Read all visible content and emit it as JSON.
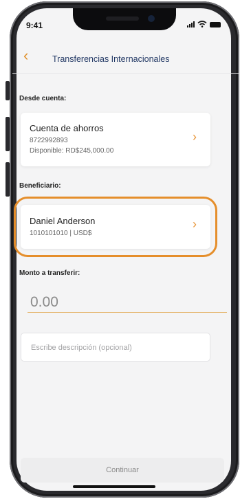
{
  "status": {
    "time": "9:41"
  },
  "nav": {
    "back_icon": "chevron-left-icon",
    "title": "Transferencias Internacionales"
  },
  "from": {
    "label": "Desde cuenta:",
    "account_name": "Cuenta de ahorros",
    "account_number": "8722992893",
    "available": "Disponible: RD$245,000.00"
  },
  "beneficiary": {
    "label": "Beneficiario:",
    "name": "Daniel Anderson",
    "details": "1010101010 | USD$"
  },
  "amount": {
    "label": "Monto a transferir:",
    "value": "0.00"
  },
  "description": {
    "placeholder": "Escribe descripción (opcional)"
  },
  "actions": {
    "continue_label": "Continuar"
  },
  "colors": {
    "accent": "#e8963a",
    "highlight": "#e58e2b",
    "title": "#243a66"
  }
}
